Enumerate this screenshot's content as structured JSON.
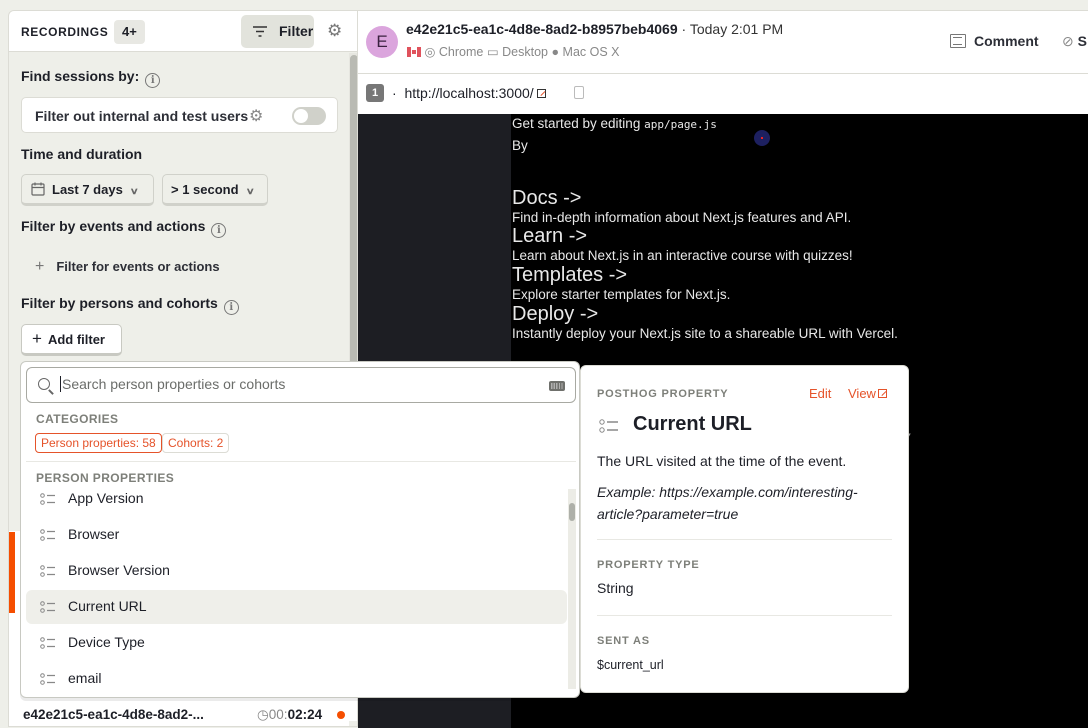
{
  "recordings": {
    "title": "RECORDINGS",
    "count_badge": "4+",
    "filter_label": "Filter"
  },
  "filters": {
    "find_sessions_label": "Find sessions by:",
    "internal_users_label": "Filter out internal and test users",
    "internal_users_enabled": false,
    "time_duration_label": "Time and duration",
    "date_range_value": "Last 7 days",
    "duration_value": "> 1 second",
    "events_actions_label": "Filter by events and actions",
    "add_event_label": "Filter for events or actions",
    "persons_cohorts_label": "Filter by persons and cohorts",
    "add_filter_label": "Add filter"
  },
  "session_list": [
    {
      "id": "e42e21c5-ea1c-4d8e-8ad2-...",
      "duration_prefix": "00:",
      "duration_main": "02:24",
      "live_dot": true
    }
  ],
  "session": {
    "avatar_letter": "E",
    "id": "e42e21c5-ea1c-4d8e-8ad2-b8957beb4069",
    "time": "· Today 2:01 PM",
    "browser": "Chrome",
    "device": "Desktop",
    "os": "Mac OS X",
    "comment_label": "Comment",
    "share_label": "S",
    "window_number": "1",
    "url_separator": "·",
    "url": "http://localhost:3000/"
  },
  "player_page": {
    "get_started": "Get started by editing ",
    "get_started_code": "app/page.js",
    "by": "By",
    "cards": [
      {
        "title": "Docs ->",
        "desc": "Find in-depth information about Next.js features and API."
      },
      {
        "title": "Learn ->",
        "desc": "Learn about Next.js in an interactive course with quizzes!"
      },
      {
        "title": "Templates ->",
        "desc": "Explore starter templates for Next.js."
      },
      {
        "title": "Deploy ->",
        "desc": "Instantly deploy your Next.js site to a shareable URL with Vercel."
      }
    ],
    "partial_glyph": "y"
  },
  "dropdown": {
    "search_placeholder": "Search person properties or cohorts",
    "search_value": "",
    "categories_label": "CATEGORIES",
    "chips": [
      {
        "label": "Person properties: 58",
        "active": true
      },
      {
        "label": "Cohorts: 2",
        "active": false
      }
    ],
    "section_label": "PERSON PROPERTIES",
    "items": [
      {
        "label": "App Version",
        "highlighted": false
      },
      {
        "label": "Browser",
        "highlighted": false
      },
      {
        "label": "Browser Version",
        "highlighted": false
      },
      {
        "label": "Current URL",
        "highlighted": true
      },
      {
        "label": "Device Type",
        "highlighted": false
      },
      {
        "label": "email",
        "highlighted": false
      }
    ]
  },
  "popover": {
    "kicker": "POSTHOG PROPERTY",
    "edit_label": "Edit",
    "view_label": "View",
    "title": "Current URL",
    "description": "The URL visited at the time of the event.",
    "example": "Example: https://example.com/interesting-article?parameter=true",
    "property_type_label": "PROPERTY TYPE",
    "property_type": "String",
    "sent_as_label": "SENT AS",
    "sent_as": "$current_url"
  },
  "colors": {
    "accent": "#f54e00",
    "link": "#e5532a",
    "avatar_bg": "#dba5dd"
  }
}
